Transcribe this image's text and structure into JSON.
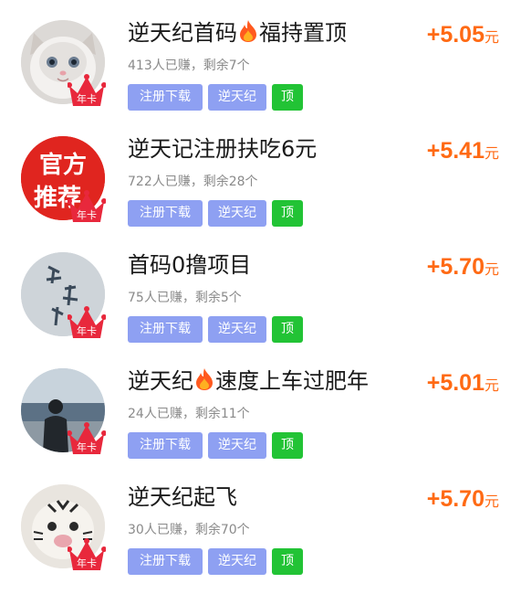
{
  "items": [
    {
      "title_a": "逆天纪首码",
      "title_b": "福持置顶",
      "stats": "413人已赚，剩余7个",
      "reward": "+5.05",
      "reward_unit": "元",
      "tag_register": "注册下载",
      "tag_brand": "逆天纪",
      "tag_top": "顶",
      "badge": "年卡",
      "avatar": "cat-avatar"
    },
    {
      "title_a": "逆天记注册扶吃6元",
      "title_b": "",
      "stats": "722人已赚，剩余28个",
      "reward": "+5.41",
      "reward_unit": "元",
      "tag_register": "注册下载",
      "tag_brand": "逆天纪",
      "tag_top": "顶",
      "badge": "年卡",
      "avatar": "official-recommend-avatar",
      "avatar_text_1": "官方",
      "avatar_text_2": "推荐"
    },
    {
      "title_a": "首码0撸项目",
      "title_b": "",
      "stats": "75人已赚，剩余5个",
      "reward": "+5.70",
      "reward_unit": "元",
      "tag_register": "注册下载",
      "tag_brand": "逆天纪",
      "tag_top": "顶",
      "badge": "年卡",
      "avatar": "calligraphy-avatar"
    },
    {
      "title_a": "逆天纪",
      "title_b": "速度上车过肥年",
      "stats": "24人已赚，剩余11个",
      "reward": "+5.01",
      "reward_unit": "元",
      "tag_register": "注册下载",
      "tag_brand": "逆天纪",
      "tag_top": "顶",
      "badge": "年卡",
      "avatar": "person-seaside-avatar"
    },
    {
      "title_a": "逆天纪起飞",
      "title_b": "",
      "stats": "30人已赚，剩余70个",
      "reward": "+5.70",
      "reward_unit": "元",
      "tag_register": "注册下载",
      "tag_brand": "逆天纪",
      "tag_top": "顶",
      "badge": "年卡",
      "avatar": "tiger-avatar"
    }
  ],
  "colors": {
    "accent_orange": "#ff6a14",
    "tag_blue": "#8ea0f2",
    "tag_green": "#22c335",
    "crown_red": "#e8283c"
  }
}
